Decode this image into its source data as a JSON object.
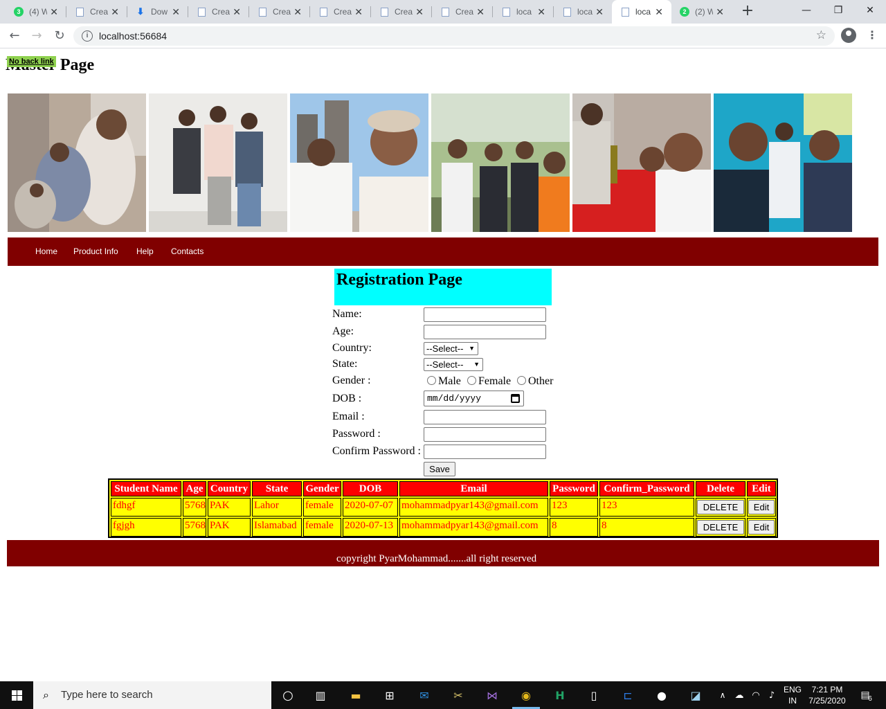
{
  "browser": {
    "tabs": [
      {
        "title": "(4) W",
        "favicon": "whatsapp-badge",
        "badge": "3"
      },
      {
        "title": "Crea",
        "favicon": "document"
      },
      {
        "title": "Dow",
        "favicon": "download"
      },
      {
        "title": "Crea",
        "favicon": "document"
      },
      {
        "title": "Crea",
        "favicon": "document"
      },
      {
        "title": "Crea",
        "favicon": "document"
      },
      {
        "title": "Crea",
        "favicon": "document"
      },
      {
        "title": "Crea",
        "favicon": "document"
      },
      {
        "title": "loca",
        "favicon": "document"
      },
      {
        "title": "loca",
        "favicon": "document"
      },
      {
        "title": "loca",
        "favicon": "document",
        "active": true
      },
      {
        "title": "(2) W",
        "favicon": "whatsapp-badge",
        "badge": "2"
      }
    ],
    "url": "localhost:56684",
    "new_tab_symbol": "+",
    "window_controls": {
      "minimize": "—",
      "restore": "❐",
      "close": "✕"
    }
  },
  "page": {
    "master_title": "Master Page",
    "back_link": "No back link",
    "menu": [
      "Home",
      "Product Info",
      "Help",
      "Contacts"
    ],
    "heading": "Registration Page",
    "form": {
      "labels": {
        "name": "Name:",
        "age": "Age:",
        "country": "Country:",
        "state": "State:",
        "gender": "Gender :",
        "dob": "DOB :",
        "email": "Email :",
        "password": "Password :",
        "confirm": "Confirm Password :"
      },
      "country_selected": "--Select--",
      "state_selected": "--Select--",
      "gender_options": [
        "Male",
        "Female",
        "Other"
      ],
      "dob_placeholder": "mm/dd/yyyy",
      "save_label": "Save"
    },
    "table": {
      "headers": [
        "Student Name",
        "Age",
        "Country",
        "State",
        "Gender",
        "DOB",
        "Email",
        "Password",
        "Confirm_Password",
        "Delete",
        "Edit"
      ],
      "rows": [
        {
          "name": "fdhgf",
          "age": "5768",
          "country": "PAK",
          "state": "Lahor",
          "gender": "female",
          "dob": "2020-07-07",
          "email": "mohammadpyar143@gmail.com",
          "password": "123",
          "confirm": "123",
          "delete": "DELETE",
          "edit": "Edit"
        },
        {
          "name": "fgjgh",
          "age": "5768",
          "country": "PAK",
          "state": "Islamabad",
          "gender": "female",
          "dob": "2020-07-13",
          "email": "mohammadpyar143@gmail.com",
          "password": "8",
          "confirm": "8",
          "delete": "DELETE",
          "edit": "Edit"
        }
      ]
    },
    "footer": "copyright PyarMohammad.......all right reserved"
  },
  "taskbar": {
    "search_placeholder": "Type here to search",
    "language": "ENG",
    "region": "IN",
    "time": "7:21 PM",
    "date": "7/25/2020",
    "notifications": "6"
  },
  "colors": {
    "menu_bg": "#800000",
    "heading_bg": "#00ffff",
    "table_header": "#ff0000",
    "table_body": "#ffff00",
    "back_link_bg": "#8fd14f"
  }
}
